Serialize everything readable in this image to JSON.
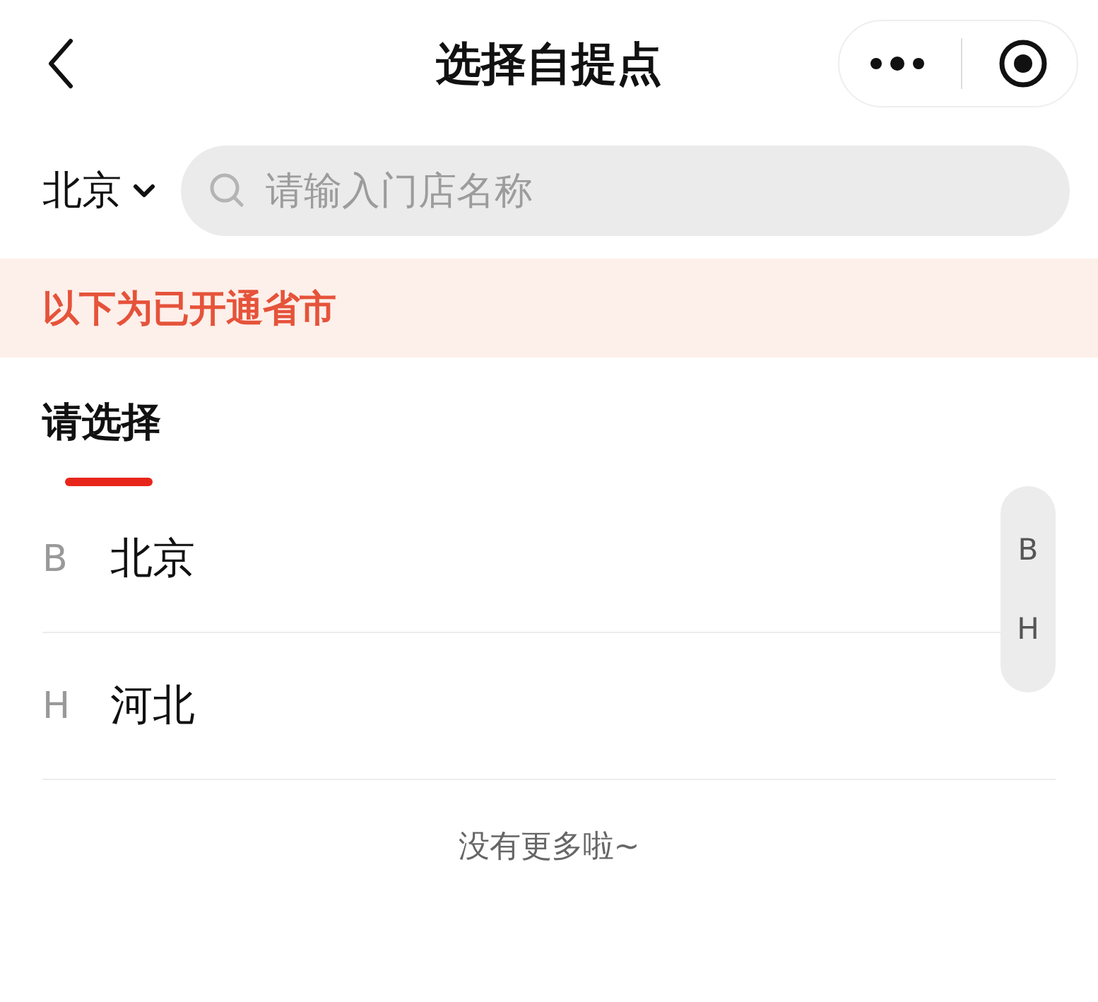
{
  "header": {
    "title": "选择自提点"
  },
  "search": {
    "city": "北京",
    "placeholder": "请输入门店名称"
  },
  "notice": "以下为已开通省市",
  "tabs": [
    {
      "label": "请选择",
      "selected": true
    }
  ],
  "rows": [
    {
      "letter": "B",
      "name": "北京"
    },
    {
      "letter": "H",
      "name": "河北"
    }
  ],
  "index_bar": [
    "B",
    "H"
  ],
  "footer": "没有更多啦~"
}
